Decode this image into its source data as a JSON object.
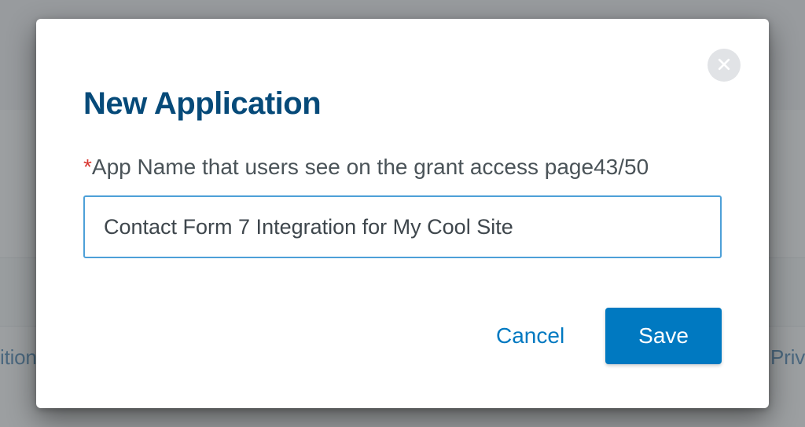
{
  "bg": {
    "peek_left": "ition",
    "peek_right": "Priv"
  },
  "modal": {
    "title": "New Application",
    "required_mark": "*",
    "field_label": "App Name that users see on the grant access page",
    "char_counter": "43/50",
    "app_name_value": "Contact Form 7 Integration for My Cool Site",
    "cancel_label": "Cancel",
    "save_label": "Save"
  }
}
